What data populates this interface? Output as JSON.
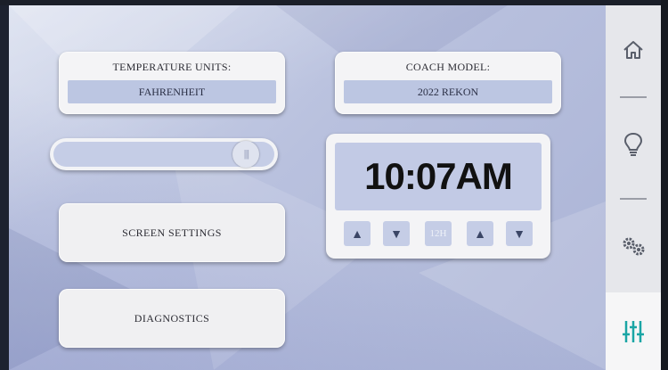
{
  "temperature": {
    "title": "TEMPERATURE UNITS:",
    "value": "FAHRENHEIT"
  },
  "coach": {
    "title": "COACH MODEL:",
    "value": "2022 REKON"
  },
  "brightness": {
    "level": 0.92
  },
  "buttons": {
    "screen_settings": "SCREEN SETTINGS",
    "diagnostics": "DIAGNOSTICS"
  },
  "clock": {
    "time": "10:07AM",
    "hour_up": "▲",
    "hour_down": "▼",
    "mode_label": "12H",
    "minute_up": "▲",
    "minute_down": "▼"
  },
  "sidebar": {
    "items": [
      {
        "icon": "home-icon",
        "active": false
      },
      {
        "icon": "lightbulb-icon",
        "active": false
      },
      {
        "icon": "gears-icon",
        "active": false
      },
      {
        "icon": "sliders-icon",
        "active": true
      }
    ],
    "accent": "#1aa5a5"
  }
}
